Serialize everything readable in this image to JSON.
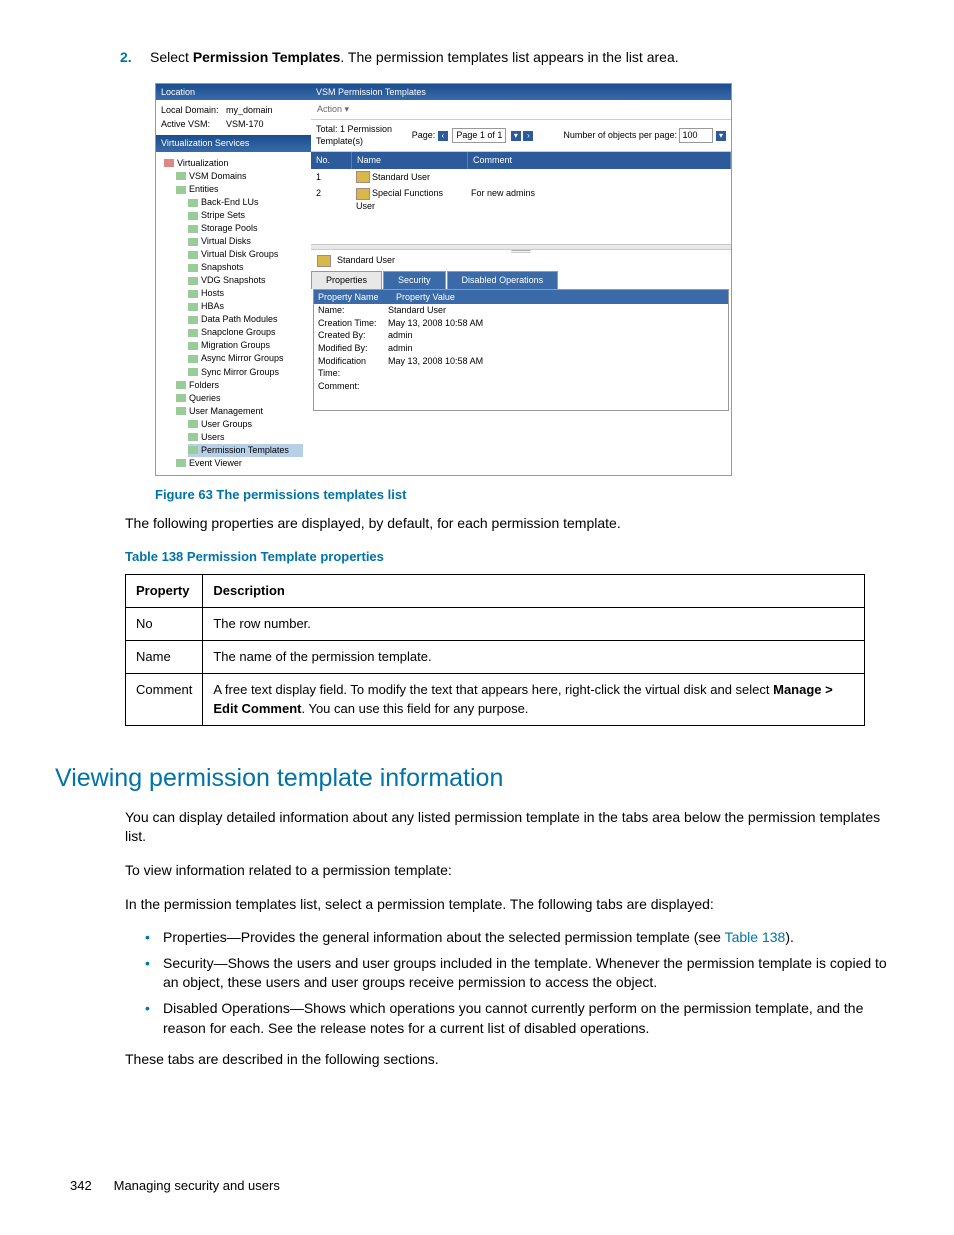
{
  "step": {
    "num": "2.",
    "pre": "Select ",
    "bold": "Permission Templates",
    "post": ". The permission templates list appears in the list area."
  },
  "ss": {
    "location_title": "Location",
    "local_domain_label": "Local Domain:",
    "local_domain": "my_domain",
    "active_vsm_label": "Active VSM:",
    "active_vsm": "VSM-170",
    "vserv_title": "Virtualization Services",
    "tree": [
      {
        "d": 0,
        "t": "Virtualization"
      },
      {
        "d": 1,
        "t": "VSM Domains"
      },
      {
        "d": 1,
        "t": "Entities"
      },
      {
        "d": 2,
        "t": "Back-End LUs"
      },
      {
        "d": 2,
        "t": "Stripe Sets"
      },
      {
        "d": 2,
        "t": "Storage Pools"
      },
      {
        "d": 2,
        "t": "Virtual Disks"
      },
      {
        "d": 2,
        "t": "Virtual Disk Groups"
      },
      {
        "d": 2,
        "t": "Snapshots"
      },
      {
        "d": 2,
        "t": "VDG Snapshots"
      },
      {
        "d": 2,
        "t": "Hosts"
      },
      {
        "d": 2,
        "t": "HBAs"
      },
      {
        "d": 2,
        "t": "Data Path Modules"
      },
      {
        "d": 2,
        "t": "Snapclone Groups"
      },
      {
        "d": 2,
        "t": "Migration Groups"
      },
      {
        "d": 2,
        "t": "Async Mirror Groups"
      },
      {
        "d": 2,
        "t": "Sync Mirror Groups"
      },
      {
        "d": 1,
        "t": "Folders"
      },
      {
        "d": 1,
        "t": "Queries"
      },
      {
        "d": 1,
        "t": "User Management"
      },
      {
        "d": 2,
        "t": "User Groups"
      },
      {
        "d": 2,
        "t": "Users"
      },
      {
        "d": 2,
        "t": "Permission Templates",
        "sel": true
      },
      {
        "d": 1,
        "t": "Event Viewer"
      }
    ],
    "right_title": "VSM Permission Templates",
    "action": "Action ▾",
    "total": "Total: 1 Permission Template(s)",
    "page_label": "Page:",
    "page_box": "Page 1 of 1",
    "objs_label": "Number of objects per page:",
    "objs_val": "100",
    "col_no": "No.",
    "col_name": "Name",
    "col_comment": "Comment",
    "rows": [
      {
        "no": "1",
        "name": "Standard User",
        "comment": ""
      },
      {
        "no": "2",
        "name": "Special Functions User",
        "comment": "For new admins"
      }
    ],
    "selected": "Standard User",
    "tabs": {
      "props": "Properties",
      "sec": "Security",
      "dis": "Disabled Operations"
    },
    "propth1": "Property Name",
    "propth2": "Property Value",
    "props": [
      {
        "n": "Name:",
        "v": "Standard User"
      },
      {
        "n": "Creation Time:",
        "v": "May 13, 2008 10:58 AM"
      },
      {
        "n": "Created By:",
        "v": "admin"
      },
      {
        "n": "Modified By:",
        "v": "admin"
      },
      {
        "n": "Modification Time:",
        "v": "May 13, 2008 10:58 AM"
      },
      {
        "n": "Comment:",
        "v": ""
      }
    ]
  },
  "fig_caption": "Figure 63 The permissions templates list",
  "intro_text": "The following properties are displayed, by default, for each permission template.",
  "table_caption": "Table 138 Permission Template properties",
  "table": {
    "h1": "Property",
    "h2": "Description",
    "rows": [
      {
        "p": "No",
        "d": "The row number."
      },
      {
        "p": "Name",
        "d": "The name of the permission template."
      },
      {
        "p": "Comment",
        "d_pre": "A free text display field. To modify the text that appears here, right-click the virtual disk and select ",
        "d_b": "Manage > Edit Comment",
        "d_post": ". You can use this field for any purpose."
      }
    ]
  },
  "heading": "Viewing permission template information",
  "p1": "You can display detailed information about any listed permission template in the tabs area below the permission templates list.",
  "p2": "To view information related to a permission template:",
  "p3": "In the permission templates list, select a permission template. The following tabs are displayed:",
  "bullets": [
    {
      "pre": "Properties—Provides the general information about the selected permission template (see ",
      "link": "Table 138",
      "post": ")."
    },
    {
      "text": "Security—Shows the users and user groups included in the template. Whenever the permission template is copied to an object, these users and user groups receive permission to access the object."
    },
    {
      "text": "Disabled Operations—Shows which operations you cannot currently perform on the permission template, and the reason for each. See the release notes for a current list of disabled operations."
    }
  ],
  "p4": "These tabs are described in the following sections.",
  "footer": {
    "page": "342",
    "title": "Managing security and users"
  }
}
